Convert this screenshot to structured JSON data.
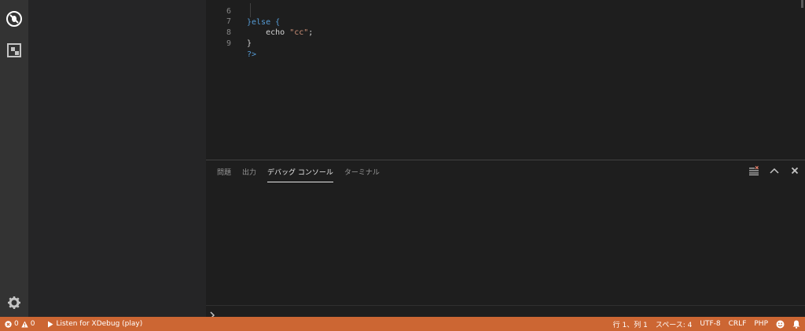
{
  "activity_bar": {
    "icons": [
      "debug-icon",
      "extensions-icon",
      "gear-icon"
    ]
  },
  "editor": {
    "lines": [
      {
        "num": "6",
        "code": "}else {"
      },
      {
        "num": "7",
        "code": "    echo \"cc\";"
      },
      {
        "num": "8",
        "code": "}"
      },
      {
        "num": "9",
        "code": "?>"
      }
    ]
  },
  "panel": {
    "tabs": [
      {
        "label": "問題"
      },
      {
        "label": "出力"
      },
      {
        "label": "デバッグ コンソール",
        "active": true
      },
      {
        "label": "ターミナル"
      }
    ],
    "actions": [
      "clear-console-icon",
      "maximize-panel-icon",
      "close-panel-icon"
    ]
  },
  "status_bar": {
    "errors": "0",
    "warnings": "0",
    "debug_config": "Listen for XDebug (play)",
    "position": "行 1、列 1",
    "spaces": "スペース: 4",
    "encoding": "UTF-8",
    "eol": "CRLF",
    "language": "PHP",
    "colors": {
      "background": "#cc6633"
    }
  }
}
